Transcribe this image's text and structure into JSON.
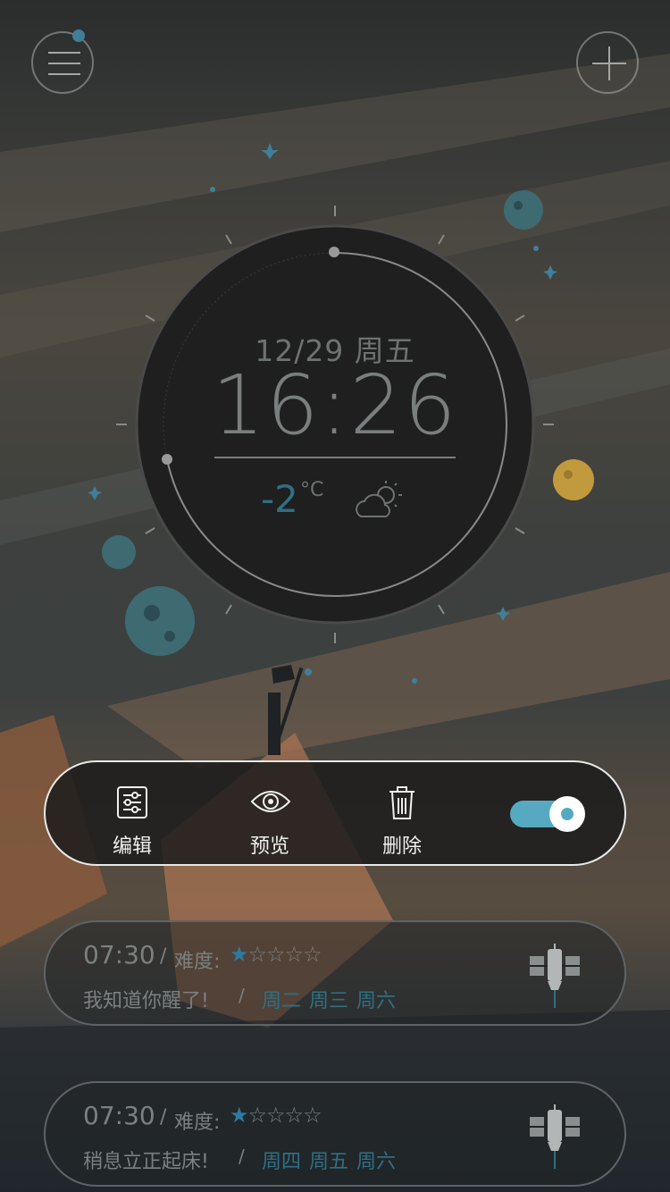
{
  "clock": {
    "date": "12/29 周五",
    "time": "16:26",
    "temperature": "-2",
    "temperature_unit": "°C",
    "weather_icon": "partly-cloudy-icon"
  },
  "header": {
    "menu_icon": "menu-icon",
    "add_icon": "plus-icon",
    "has_notification": true
  },
  "actions": {
    "edit_label": "编辑",
    "preview_label": "预览",
    "delete_label": "删除",
    "toggle_on": true
  },
  "alarms": [
    {
      "time": "07:30",
      "difficulty_label": "难度:",
      "difficulty": 1,
      "difficulty_max": 5,
      "stars_on": "★",
      "stars_off": "☆☆☆☆",
      "message": "我知道你醒了!",
      "days": "周二 周三 周六",
      "icon": "satellite-icon"
    },
    {
      "time": "07:30",
      "difficulty_label": "难度:",
      "difficulty": 1,
      "difficulty_max": 5,
      "stars_on": "★",
      "stars_off": "☆☆☆☆",
      "message": "稍息立正起床!",
      "days": "周四 周五 周六",
      "icon": "satellite-icon"
    }
  ],
  "colors": {
    "accent": "#57a9c2",
    "accent_dark": "#2f6f84",
    "clock_face": "#1f1f1f"
  }
}
